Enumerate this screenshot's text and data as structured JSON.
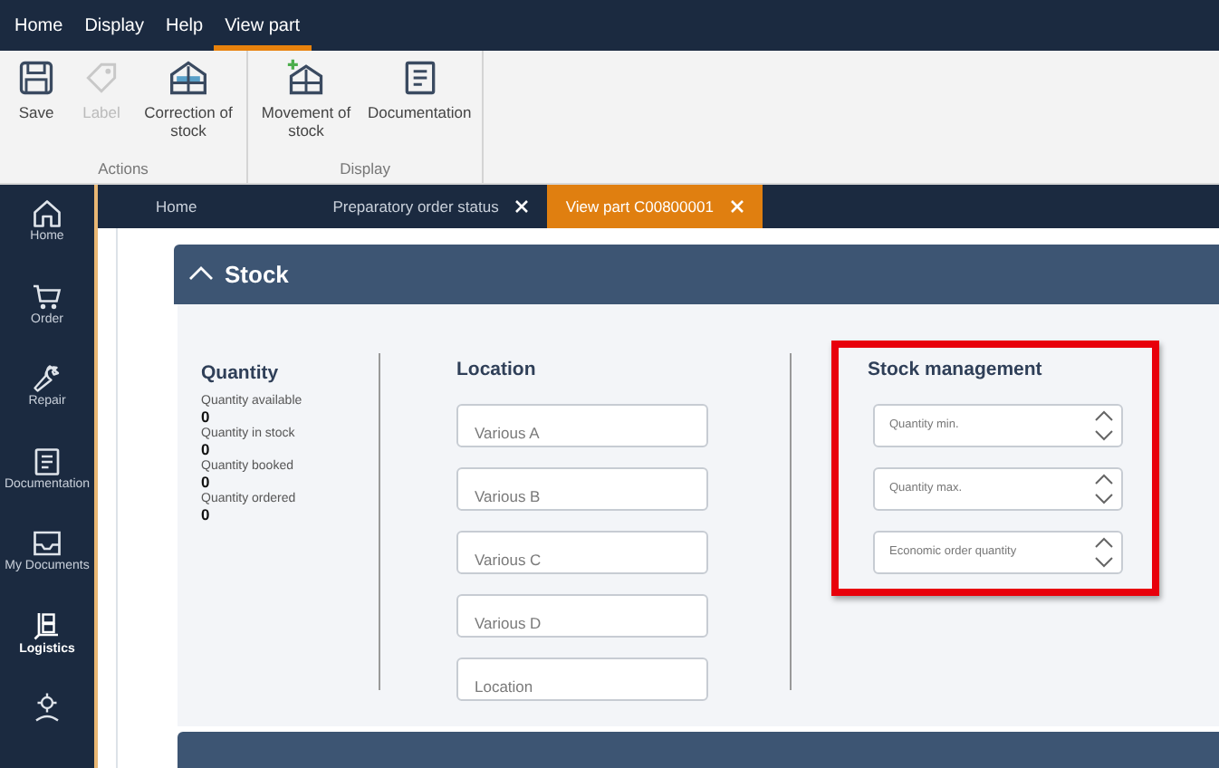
{
  "menu": [
    {
      "label": "Home",
      "selected": false
    },
    {
      "label": "Display",
      "selected": false
    },
    {
      "label": "Help",
      "selected": false
    },
    {
      "label": "View part",
      "selected": true
    }
  ],
  "ribbon": {
    "groups": [
      {
        "title": "Actions",
        "buttons": [
          {
            "label": "Save",
            "kind": "save",
            "disabled": false
          },
          {
            "label": "Label",
            "kind": "label",
            "disabled": true
          },
          {
            "label": "Correction of stock",
            "kind": "correction",
            "disabled": false
          }
        ]
      },
      {
        "title": "Display",
        "buttons": [
          {
            "label": "Movement of stock",
            "kind": "movement",
            "disabled": false
          },
          {
            "label": "Documentation",
            "kind": "document",
            "disabled": false
          }
        ]
      }
    ]
  },
  "sidebar": {
    "items": [
      {
        "label": "Home",
        "kind": "home",
        "selected": false
      },
      {
        "label": "Order",
        "kind": "cart",
        "selected": false
      },
      {
        "label": "Repair",
        "kind": "wrench",
        "selected": false
      },
      {
        "label": "Documentation",
        "kind": "document",
        "selected": false
      },
      {
        "label": "My Documents",
        "kind": "inbox",
        "selected": false
      },
      {
        "label": "Logistics",
        "kind": "logistics",
        "selected": true
      },
      {
        "kind": "gear",
        "selected": false
      }
    ]
  },
  "tabs": [
    {
      "label": "Home",
      "closable": false,
      "selected": false
    },
    {
      "label": "Preparatory order status",
      "closable": true,
      "selected": false
    },
    {
      "label": "View part C00800001",
      "closable": true,
      "selected": true
    }
  ],
  "stock": {
    "title": "Stock",
    "expanded": true,
    "quantity": {
      "title": "Quantity",
      "rows": [
        {
          "label": "Quantity available",
          "value": "0"
        },
        {
          "label": "Quantity in stock",
          "value": "0"
        },
        {
          "label": "Quantity booked",
          "value": "0"
        },
        {
          "label": "Quantity ordered",
          "value": "0"
        }
      ]
    },
    "location": {
      "title": "Location",
      "fields": [
        {
          "placeholder": "Various A"
        },
        {
          "placeholder": "Various B"
        },
        {
          "placeholder": "Various C"
        },
        {
          "placeholder": "Various D"
        },
        {
          "placeholder": "Location"
        }
      ]
    },
    "stock_management": {
      "title": "Stock management",
      "highlighted": true,
      "fields": [
        {
          "placeholder": "Quantity min."
        },
        {
          "placeholder": "Quantity max."
        },
        {
          "placeholder": "Economic order quantity"
        }
      ]
    }
  }
}
